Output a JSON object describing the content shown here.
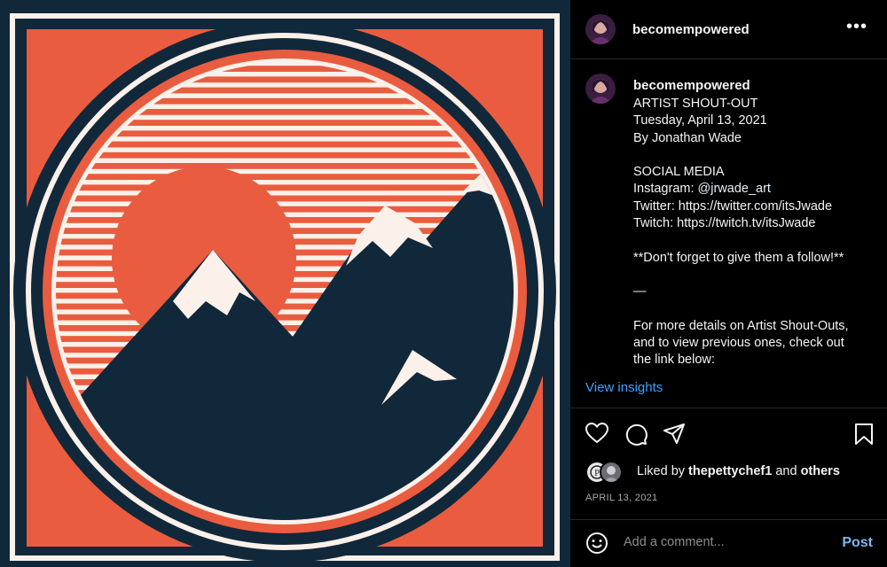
{
  "post": {
    "username": "becomempowered",
    "more_icon": "more-horizontal-icon",
    "caption": {
      "username": "becomempowered",
      "lines": [
        "ARTIST SHOUT-OUT",
        "Tuesday, April 13, 2021",
        "By Jonathan Wade",
        "",
        "SOCIAL MEDIA",
        "Instagram: ",
        "Twitter: https://twitter.com/itsJwade",
        "Twitch: https://twitch.tv/itsJwade",
        "",
        "**Don't forget to give them a follow!**",
        "",
        "—",
        "",
        "For more details on Artist Shout-Outs,",
        "and to view previous ones, check out",
        "the link below:"
      ],
      "mention": "@jrwade_art"
    },
    "insights_label": "View insights",
    "likes": {
      "prefix": "Liked by ",
      "user": "thepettychef1",
      "conjunction": " and ",
      "others": "others"
    },
    "date": "APRIL 13, 2021",
    "comment": {
      "placeholder": "Add a comment...",
      "post_label": "Post"
    }
  },
  "colors": {
    "navy": "#11283a",
    "orange": "#ea5c3f",
    "cream": "#fbf1ea",
    "link_blue": "#3ea0ff",
    "post_blue": "#7cb8f0"
  }
}
